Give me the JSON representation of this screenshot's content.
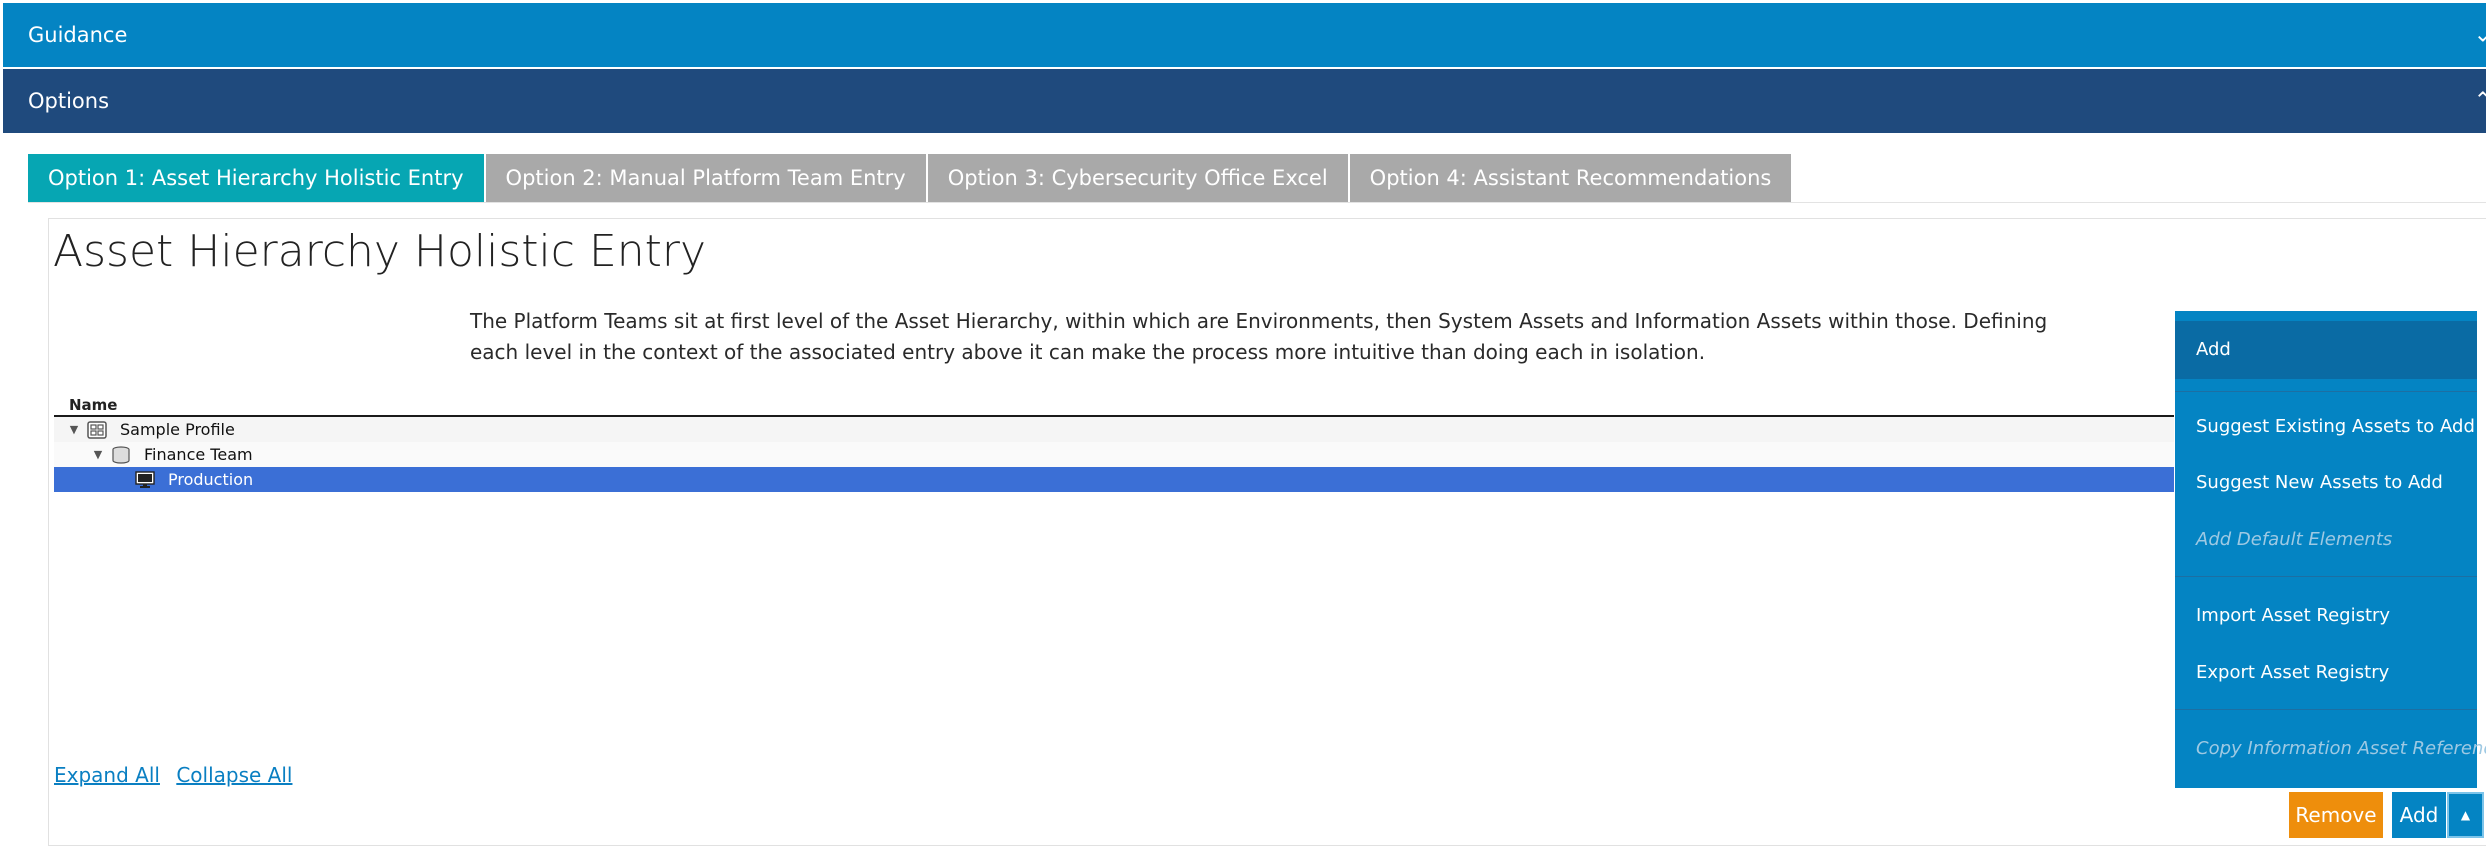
{
  "sections": {
    "guidance_title": "Guidance",
    "options_title": "Options"
  },
  "tabs": [
    {
      "label": "Option 1: Asset Hierarchy Holistic Entry",
      "active": true
    },
    {
      "label": "Option 2: Manual Platform Team Entry",
      "active": false
    },
    {
      "label": "Option 3: Cybersecurity Office Excel",
      "active": false
    },
    {
      "label": "Option 4: Assistant Recommendations",
      "active": false
    }
  ],
  "main": {
    "title": "Asset Hierarchy Holistic Entry",
    "description": "The Platform Teams sit at first level of the Asset Hierarchy, within which are Environments, then System Assets and Information Assets within those. Defining each level in the context of the associated entry above it can make the process more intuitive than doing each in isolation."
  },
  "tree": {
    "column_name": "Name",
    "rows": [
      {
        "label": "Sample Profile",
        "icon": "profile-icon",
        "expanded": true
      },
      {
        "label": "Finance Team",
        "icon": "database-stack-icon",
        "expanded": true
      },
      {
        "label": "Production",
        "icon": "monitor-icon",
        "selected": true
      }
    ]
  },
  "links": {
    "expand_all": "Expand All",
    "collapse_all": "Collapse All"
  },
  "dropdown_menu": {
    "items": [
      {
        "label": "Add",
        "enabled": true,
        "highlighted": true
      },
      {
        "label": "Suggest Existing Assets to Add",
        "enabled": true
      },
      {
        "label": "Suggest New Assets to Add",
        "enabled": true
      },
      {
        "label": "Add Default Elements",
        "enabled": false
      },
      {
        "label": "Import Asset Registry",
        "enabled": true
      },
      {
        "label": "Export Asset Registry",
        "enabled": true
      },
      {
        "label": "Copy Information Asset References",
        "enabled": false
      }
    ]
  },
  "buttons": {
    "remove_label": "Remove",
    "add_label": "Add"
  },
  "colors": {
    "guidance_bar": "#0484c3",
    "options_bar": "#1f4a7d",
    "active_tab": "#06a6b3",
    "inactive_tab": "#a9a9a9",
    "selected_row": "#3b6fd6",
    "remove_button": "#ee8e0c",
    "menu_background": "#0484c3"
  }
}
